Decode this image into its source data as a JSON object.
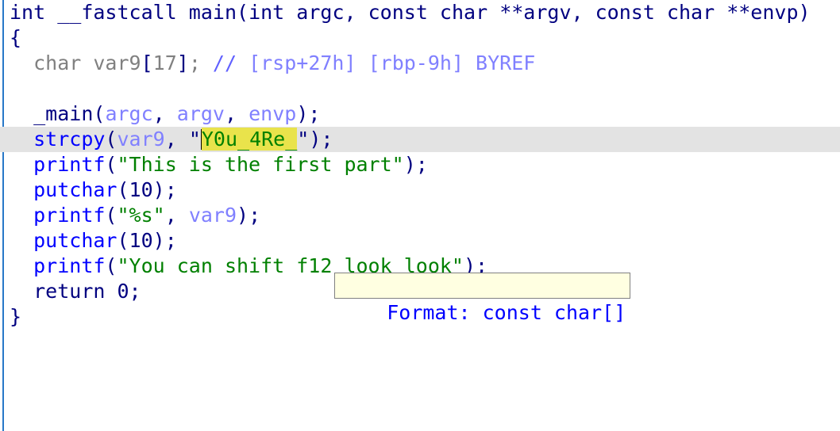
{
  "view": {
    "name": "hex-rays-pseudocode",
    "background": "#ffffff",
    "indent_bar_color": "#2878c8",
    "current_line_color": "#e3e3e3",
    "selection_color": "#e9e34b"
  },
  "code": {
    "lines": [
      {
        "index": 0,
        "current": false,
        "text": "int __fastcall main(int argc, const char **argv, const char **envp)",
        "tokens": [
          {
            "t": "int ",
            "c": "t-keyword"
          },
          {
            "t": "__fastcall ",
            "c": "t-keyword"
          },
          {
            "t": "main",
            "c": "t-funcname"
          },
          {
            "t": "(",
            "c": "t-punct"
          },
          {
            "t": "int ",
            "c": "t-keyword"
          },
          {
            "t": "argc",
            "c": "t-keyword"
          },
          {
            "t": ", ",
            "c": "t-punct"
          },
          {
            "t": "const char ",
            "c": "t-keyword"
          },
          {
            "t": "**argv",
            "c": "t-keyword"
          },
          {
            "t": ", ",
            "c": "t-punct"
          },
          {
            "t": "const char ",
            "c": "t-keyword"
          },
          {
            "t": "**envp",
            "c": "t-keyword"
          },
          {
            "t": ")",
            "c": "t-punct"
          }
        ]
      },
      {
        "index": 1,
        "current": false,
        "text": "{",
        "tokens": [
          {
            "t": "{",
            "c": "t-punct"
          }
        ]
      },
      {
        "index": 2,
        "current": false,
        "text": "  char var9[17]; // [rsp+27h] [rbp-9h] BYREF",
        "tokens": [
          {
            "t": "  ",
            "c": "t-punct"
          },
          {
            "t": "char var9",
            "c": "t-comment"
          },
          {
            "t": "[",
            "c": "t-punct"
          },
          {
            "t": "17",
            "c": "t-comment"
          },
          {
            "t": "]",
            "c": "t-punct"
          },
          {
            "t": "; ",
            "c": "t-comment"
          },
          {
            "t": "// ",
            "c": "t-commentmk"
          },
          {
            "t": "[rsp+27h] [rbp-9h] BYREF",
            "c": "t-commentsl"
          }
        ]
      },
      {
        "index": 3,
        "current": false,
        "text": "",
        "tokens": []
      },
      {
        "index": 4,
        "current": false,
        "text": "  _main(argc, argv, envp);",
        "tokens": [
          {
            "t": "  ",
            "c": "t-punct"
          },
          {
            "t": "_main",
            "c": "t-localfn"
          },
          {
            "t": "(",
            "c": "t-punct"
          },
          {
            "t": "argc",
            "c": "t-var"
          },
          {
            "t": ", ",
            "c": "t-punct"
          },
          {
            "t": "argv",
            "c": "t-var"
          },
          {
            "t": ", ",
            "c": "t-punct"
          },
          {
            "t": "envp",
            "c": "t-var"
          },
          {
            "t": ");",
            "c": "t-punct"
          }
        ]
      },
      {
        "index": 5,
        "current": true,
        "text": "  strcpy(var9, \"Y0u_4Re_\");",
        "selection": "Y0u_4Re_",
        "tokens": [
          {
            "t": "  ",
            "c": "t-punct"
          },
          {
            "t": "strcpy",
            "c": "t-func"
          },
          {
            "t": "(",
            "c": "t-punct"
          },
          {
            "t": "var9",
            "c": "t-var"
          },
          {
            "t": ", ",
            "c": "t-punct"
          },
          {
            "t": "\"",
            "c": "t-punct"
          },
          {
            "t": "CARET",
            "c": "caret"
          },
          {
            "t": "Y0u_4Re_",
            "c": "sel-highlight"
          },
          {
            "t": "\"",
            "c": "t-punct"
          },
          {
            "t": ");",
            "c": "t-punct"
          }
        ]
      },
      {
        "index": 6,
        "current": false,
        "text": "  printf(\"This is the first part\");",
        "tokens": [
          {
            "t": "  ",
            "c": "t-punct"
          },
          {
            "t": "printf",
            "c": "t-func"
          },
          {
            "t": "(",
            "c": "t-punct"
          },
          {
            "t": "\"This is the first part\"",
            "c": "t-string"
          },
          {
            "t": ");",
            "c": "t-punct"
          }
        ]
      },
      {
        "index": 7,
        "current": false,
        "text": "  putchar(10);",
        "tokens": [
          {
            "t": "  ",
            "c": "t-punct"
          },
          {
            "t": "putchar",
            "c": "t-func"
          },
          {
            "t": "(",
            "c": "t-punct"
          },
          {
            "t": "10",
            "c": "t-num"
          },
          {
            "t": ");",
            "c": "t-punct"
          }
        ]
      },
      {
        "index": 8,
        "current": false,
        "text": "  printf(\"%s\", var9);",
        "tokens": [
          {
            "t": "  ",
            "c": "t-punct"
          },
          {
            "t": "printf",
            "c": "t-func"
          },
          {
            "t": "(",
            "c": "t-punct"
          },
          {
            "t": "\"%s\"",
            "c": "t-string"
          },
          {
            "t": ", ",
            "c": "t-punct"
          },
          {
            "t": "var9",
            "c": "t-var"
          },
          {
            "t": ");",
            "c": "t-punct"
          }
        ]
      },
      {
        "index": 9,
        "current": false,
        "text": "  putchar(10);",
        "tokens": [
          {
            "t": "  ",
            "c": "t-punct"
          },
          {
            "t": "putchar",
            "c": "t-func"
          },
          {
            "t": "(",
            "c": "t-punct"
          },
          {
            "t": "10",
            "c": "t-num"
          },
          {
            "t": ");",
            "c": "t-punct"
          }
        ]
      },
      {
        "index": 10,
        "current": false,
        "text": "  printf(\"You can shift f12 look look\");",
        "tokens": [
          {
            "t": "  ",
            "c": "t-punct"
          },
          {
            "t": "printf",
            "c": "t-func"
          },
          {
            "t": "(",
            "c": "t-punct"
          },
          {
            "t": "\"You can shift f12 look look\"",
            "c": "t-string"
          },
          {
            "t": ");",
            "c": "t-punct"
          }
        ]
      },
      {
        "index": 11,
        "current": false,
        "text": "  return 0;",
        "tokens": [
          {
            "t": "  ",
            "c": "t-punct"
          },
          {
            "t": "return ",
            "c": "t-keyword"
          },
          {
            "t": "0",
            "c": "t-num"
          },
          {
            "t": ";",
            "c": "t-punct"
          }
        ]
      },
      {
        "index": 12,
        "current": false,
        "text": "}",
        "tokens": [
          {
            "t": "}",
            "c": "t-punct"
          }
        ]
      }
    ]
  },
  "tooltip": {
    "text": "Format: const char[]",
    "background": "#ffffe1",
    "border": "#808080",
    "text_color": "#0000ff"
  }
}
